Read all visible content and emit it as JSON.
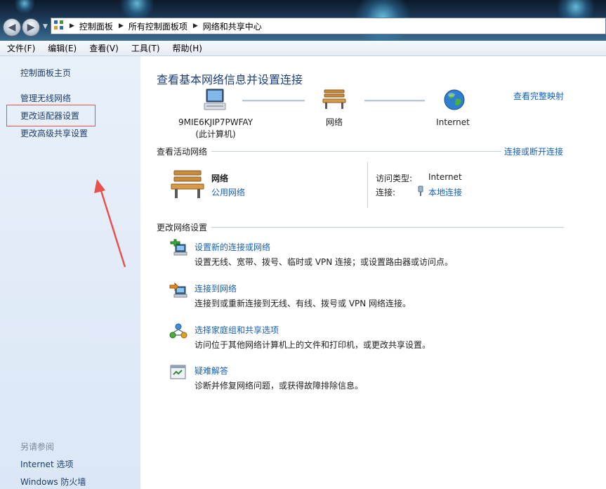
{
  "breadcrumb": [
    "控制面板",
    "所有控制面板项",
    "网络和共享中心"
  ],
  "menu": [
    "文件(F)",
    "编辑(E)",
    "查看(V)",
    "工具(T)",
    "帮助(H)"
  ],
  "sidebar": {
    "home": "控制面板主页",
    "links": [
      "管理无线网络",
      "更改适配器设置",
      "更改高级共享设置"
    ],
    "see_also_heading": "另请参阅",
    "see_also": [
      "Internet 选项",
      "Windows 防火墙"
    ]
  },
  "main": {
    "title": "查看基本网络信息并设置连接",
    "view_full_map": "查看完整映射",
    "map": {
      "computer_name": "9MIE6KJIP7PWFAY",
      "computer_sub": "(此计算机)",
      "network": "网络",
      "internet": "Internet"
    },
    "active_networks": {
      "heading": "查看活动网络",
      "connect_link": "连接或断开连接",
      "network_name": "网络",
      "network_type": "公用网络",
      "access_type_label": "访问类型:",
      "access_type_value": "Internet",
      "connections_label": "连接:",
      "connections_value": "本地连接"
    },
    "change_settings": {
      "heading": "更改网络设置",
      "tasks": [
        {
          "title": "设置新的连接或网络",
          "desc": "设置无线、宽带、拨号、临时或 VPN 连接；或设置路由器或访问点。"
        },
        {
          "title": "连接到网络",
          "desc": "连接到或重新连接到无线、有线、拨号或 VPN 网络连接。"
        },
        {
          "title": "选择家庭组和共享选项",
          "desc": "访问位于其他网络计算机上的文件和打印机，或更改共享设置。"
        },
        {
          "title": "疑难解答",
          "desc": "诊断并修复网络问题，或获得故障排除信息。"
        }
      ]
    }
  },
  "colors": {
    "link": "#1660b9",
    "title": "#1e3f7a",
    "annotation": "#e6514e"
  }
}
